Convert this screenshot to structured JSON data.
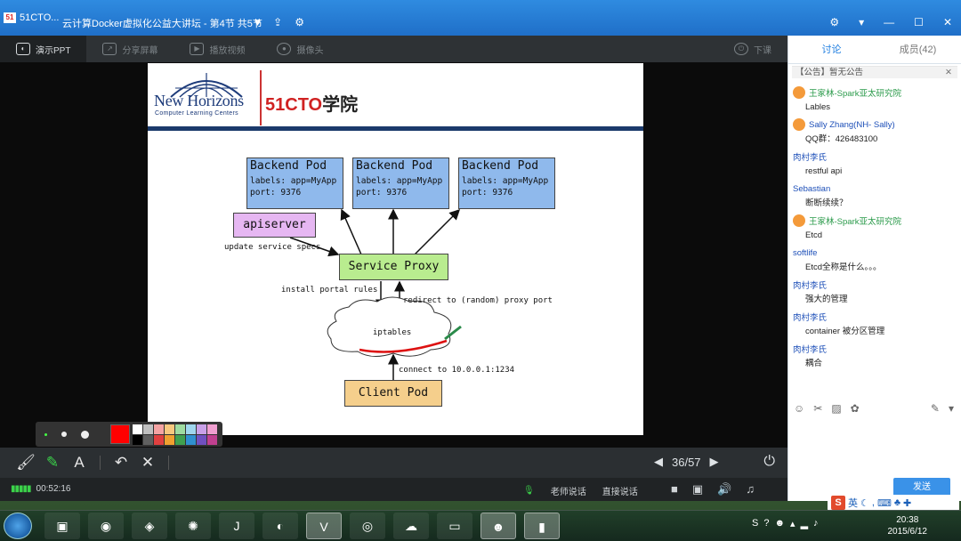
{
  "window": {
    "app_label": "51CTO...",
    "title": "云计算Docker虚拟化公益大讲坛 - 第4节 共5节"
  },
  "toolbar": {
    "items": [
      {
        "label": "演示PPT"
      },
      {
        "label": "分享屏幕"
      },
      {
        "label": "播放视频"
      },
      {
        "label": "摄像头"
      }
    ],
    "end_label": "下课"
  },
  "slide": {
    "brand_name": "New Horizons",
    "brand_tag": "Computer Learning Centers",
    "partner_brand": "51CTO",
    "partner_cn": "学院",
    "pods": [
      {
        "title": "Backend Pod",
        "labels": "labels: app=MyApp",
        "port": "port: 9376"
      },
      {
        "title": "Backend Pod",
        "labels": "labels: app=MyApp",
        "port": "port: 9376"
      },
      {
        "title": "Backend Pod",
        "labels": "labels: app=MyApp",
        "port": "port: 9376"
      }
    ],
    "apiserver": "apiserver",
    "update_specs": "update service specs",
    "service_proxy": "Service Proxy",
    "install_rules": "install portal rules",
    "redirect": "redirect to (random) proxy port",
    "iptables": "iptables",
    "connect": "connect to 10.0.0.1:1234",
    "client_pod": "Client Pod"
  },
  "palette": {
    "selected_color": "#ff0000",
    "swatches": [
      "#ffffff",
      "#c0c0c0",
      "#f4a3a3",
      "#f7c87f",
      "#9edba0",
      "#9fd6ee",
      "#c9a0e8",
      "#f09fd0",
      "#000000",
      "#606060",
      "#e04040",
      "#f0a030",
      "#40a050",
      "#3090d0",
      "#7050c0",
      "#c04090"
    ]
  },
  "controls": {
    "page_current": "36",
    "page_total": "57",
    "page_text": "36/57"
  },
  "status": {
    "elapsed": "00:52:16",
    "teacher_talk": "老师说话",
    "direct_talk": "直接说话"
  },
  "sidepanel": {
    "tab_discuss": "讨论",
    "tab_members": "成员(42)",
    "notice": "【公告】暂无公告",
    "messages": [
      {
        "user": "王家林-Spark亚太研究院",
        "text": "Lables"
      },
      {
        "user": "Sally Zhang(NH- Sally)",
        "text": "QQ群：426483100"
      },
      {
        "user": "肉村李氏",
        "text": "restful api"
      },
      {
        "user": "Sebastian",
        "text": "断断续续？"
      },
      {
        "user": "王家林-Spark亚太研究院",
        "text": "Etcd"
      },
      {
        "user": "softlife",
        "text": "Etcd全称是什么。。。"
      },
      {
        "user": "肉村李氏",
        "text": "强大的管理"
      },
      {
        "user": "肉村李氏",
        "text": "container 被分区管理"
      },
      {
        "user": "肉村李氏",
        "text": "耦合"
      }
    ],
    "send_label": "发送"
  },
  "taskbar": {
    "time": "20:38",
    "date": "2015/6/12",
    "ime_label": "英"
  }
}
